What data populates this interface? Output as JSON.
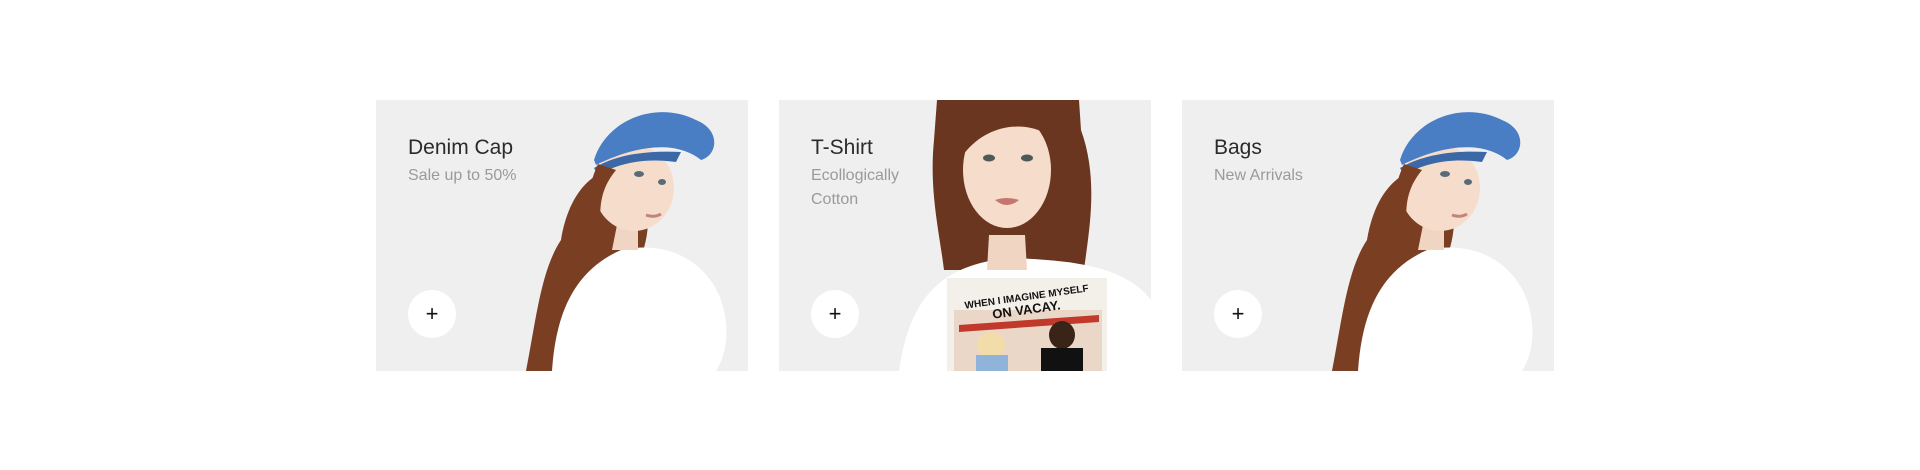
{
  "cards": [
    {
      "title": "Denim Cap",
      "subtitle": "Sale up to 50%",
      "button_icon": "plus-icon"
    },
    {
      "title": "T-Shirt",
      "subtitle": "Ecollogically Cotton",
      "button_icon": "plus-icon",
      "shirt_print": "WHEN I IMAGINE MYSELF ON VACAY."
    },
    {
      "title": "Bags",
      "subtitle": "New Arrivals",
      "button_icon": "plus-icon"
    }
  ],
  "colors": {
    "card_bg": "#f0eff0",
    "cap": "#4a7ec4",
    "hair": "#8a4a2a",
    "shirt": "#ffffff"
  }
}
